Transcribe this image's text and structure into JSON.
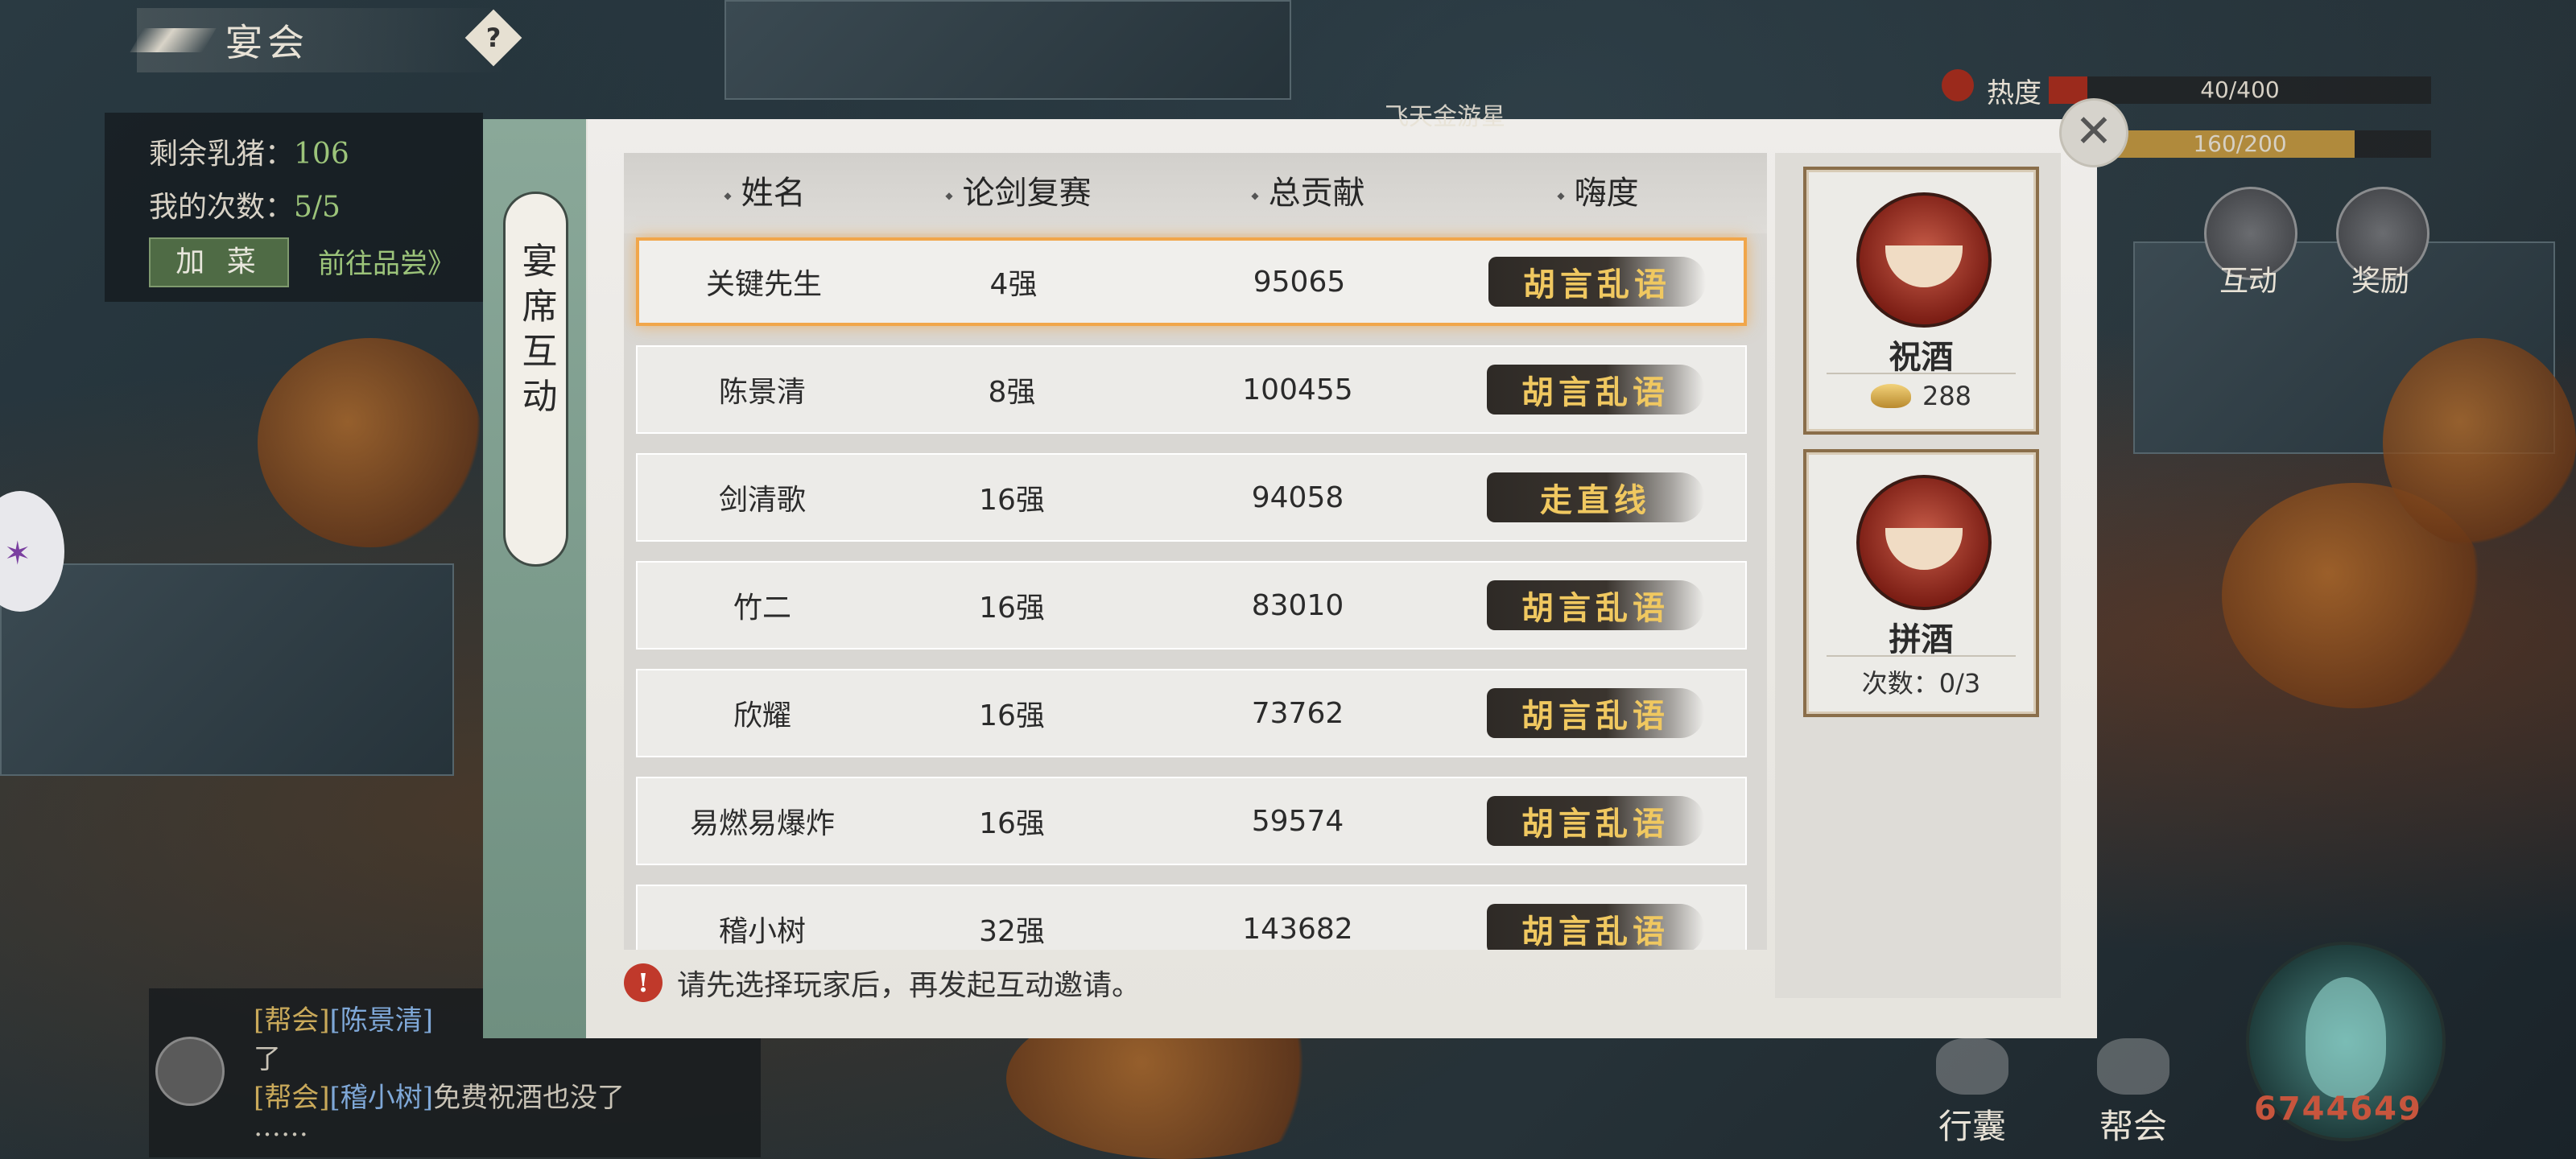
{
  "top": {
    "title": "宴会",
    "help": "?"
  },
  "info": {
    "piglet_label": "剩余乳猪：",
    "piglet_value": "106",
    "times_label": "我的次数：",
    "times_value": "5/5",
    "add_dish": "加 菜",
    "go_taste": "前往品尝》"
  },
  "hud": {
    "heat_label": "热度",
    "heat_value": "40/400",
    "heat_progress": 0.1,
    "bar2_value": "160/200",
    "bar2_progress": 0.8,
    "interact": "互动",
    "reward": "奖励",
    "bag": "行囊",
    "guild": "帮会",
    "power": "6744649"
  },
  "faint_title": "飞天金游星",
  "modal": {
    "tab_label": "宴席互动",
    "close": "✕",
    "headers": [
      "姓名",
      "论剑复赛",
      "总贡献",
      "嗨度"
    ],
    "rows": [
      {
        "name": "关键先生",
        "rank": "4强",
        "contribution": "95065",
        "tag": "胡言乱语",
        "selected": true
      },
      {
        "name": "陈景清",
        "rank": "8强",
        "contribution": "100455",
        "tag": "胡言乱语"
      },
      {
        "name": "剑清歌",
        "rank": "16强",
        "contribution": "94058",
        "tag": "走直线"
      },
      {
        "name": "竹二",
        "rank": "16强",
        "contribution": "83010",
        "tag": "胡言乱语"
      },
      {
        "name": "欣耀",
        "rank": "16强",
        "contribution": "73762",
        "tag": "胡言乱语"
      },
      {
        "name": "易燃易爆炸",
        "rank": "16强",
        "contribution": "59574",
        "tag": "胡言乱语"
      },
      {
        "name": "稽小树",
        "rank": "32强",
        "contribution": "143682",
        "tag": "胡言乱语"
      }
    ],
    "notice": "请先选择玩家后，再发起互动邀请。",
    "actions": [
      {
        "title": "祝酒",
        "sub": "288"
      },
      {
        "title": "拼酒",
        "sub": "次数：0/3"
      }
    ]
  },
  "chat": {
    "line1_tag1": "[帮会]",
    "line1_name": "[陈景清]",
    "line2": "了",
    "line3_tag1": "[帮会]",
    "line3_name": "[稽小树]",
    "line3_text": "免费祝酒也没了",
    "line4": "……"
  },
  "colors": {
    "accent_orange": "#f1a64a",
    "green_text": "#9cc47a",
    "tag_gold": "#f0c860",
    "tab_green": "#7f9f90"
  }
}
